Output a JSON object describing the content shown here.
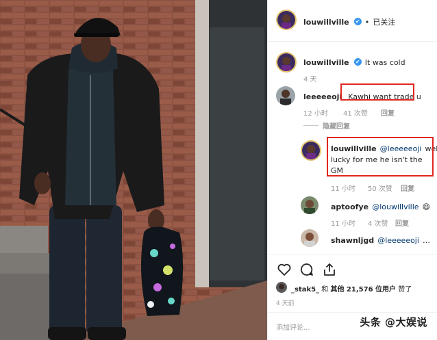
{
  "header": {
    "username": "louwillville",
    "verified_glyph": "✔",
    "separator": "•",
    "follow_status": "已关注"
  },
  "caption": {
    "username": "louwillville",
    "text": "It was cold",
    "time": "4 天"
  },
  "comments": [
    {
      "username": "leeeeeoji",
      "text": "Kawhi want trade u",
      "time": "12 小时",
      "likes": "41 次赞",
      "reply": "回复",
      "hide_replies": "隐藏回复",
      "highlighted": true
    },
    {
      "username": "louwillville",
      "mention": "@leeeeeoji",
      "text_line1": "well",
      "text_line2": "lucky for me he isn't the",
      "text_line3": "GM",
      "time": "11 小时",
      "likes": "50 次赞",
      "reply": "回复",
      "highlighted": true
    },
    {
      "username": "aptoofye",
      "mention": "@louwillville",
      "emoji": "😄",
      "time": "11 小时",
      "likes": "4 次赞",
      "reply": "回复"
    },
    {
      "username": "shawnljgd",
      "mention": "@leeeeeoji",
      "text": "…"
    }
  ],
  "likes_line": {
    "user": "_stak5_",
    "middle": " 和 ",
    "others": "其他 21,576 位用户",
    "suffix": " 赞了"
  },
  "post_time": "4 天前",
  "add_comment_placeholder": "添加评论...",
  "watermark": "头条 @大娱说",
  "colors": {
    "highlight_box": "#e0271f",
    "verified_badge": "#3897f0",
    "mention": "#00376b"
  }
}
